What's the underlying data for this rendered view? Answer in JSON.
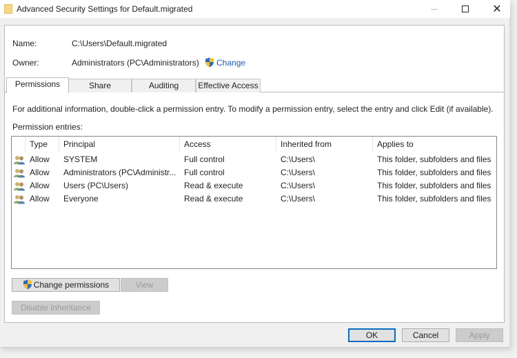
{
  "window": {
    "title": "Advanced Security Settings for Default.migrated",
    "icon": "folder-icon",
    "controls": {
      "minimize": "minimize-icon",
      "maximize": "maximize-icon",
      "close": "✕"
    }
  },
  "fields": {
    "name_label": "Name:",
    "name_value": "C:\\Users\\Default.migrated",
    "owner_label": "Owner:",
    "owner_value": "Administrators (PC\\Administrators)",
    "change_link": "Change"
  },
  "tabs": [
    {
      "label": "Permissions",
      "active": true
    },
    {
      "label": "Share",
      "active": false
    },
    {
      "label": "Auditing",
      "active": false
    },
    {
      "label": "Effective Access",
      "active": false
    }
  ],
  "permissions": {
    "info_text": "For additional information, double-click a permission entry. To modify a permission entry, select the entry and click Edit (if available).",
    "entries_label": "Permission entries:",
    "columns": [
      "Type",
      "Principal",
      "Access",
      "Inherited from",
      "Applies to"
    ],
    "rows": [
      {
        "type": "Allow",
        "principal": "SYSTEM",
        "access": "Full control",
        "inherited_from": "C:\\Users\\",
        "applies_to": "This folder, subfolders and files"
      },
      {
        "type": "Allow",
        "principal": "Administrators (PC\\Administr...",
        "access": "Full control",
        "inherited_from": "C:\\Users\\",
        "applies_to": "This folder, subfolders and files"
      },
      {
        "type": "Allow",
        "principal": "Users (PC\\Users)",
        "access": "Read & execute",
        "inherited_from": "C:\\Users\\",
        "applies_to": "This folder, subfolders and files"
      },
      {
        "type": "Allow",
        "principal": "Everyone",
        "access": "Read & execute",
        "inherited_from": "C:\\Users\\",
        "applies_to": "This folder, subfolders and files"
      }
    ],
    "change_permissions_button": "Change permissions",
    "view_button": "View",
    "disable_inheritance_button": "Disable inheritance"
  },
  "footer": {
    "ok": "OK",
    "cancel": "Cancel",
    "apply": "Apply"
  },
  "colors": {
    "link": "#1a5fb4",
    "ok_border": "#0b6cc0",
    "folder": "#f5d783"
  }
}
